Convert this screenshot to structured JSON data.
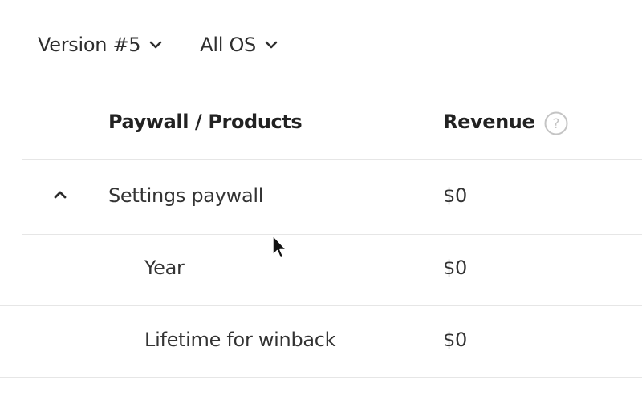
{
  "filters": {
    "version": {
      "label": "Version #5",
      "icon": "chevron-down-icon"
    },
    "os": {
      "label": "All OS",
      "icon": "chevron-down-icon"
    }
  },
  "table": {
    "columns": {
      "name": "Paywall / Products",
      "revenue": "Revenue"
    },
    "help_icon": "question-circle-icon",
    "paywall": {
      "name": "Settings paywall",
      "revenue": "$0",
      "expanded": true,
      "toggle_icon": "chevron-up-icon",
      "products": [
        {
          "name": "Year",
          "revenue": "$0"
        },
        {
          "name": "Lifetime for winback",
          "revenue": "$0"
        }
      ]
    }
  },
  "colors": {
    "text": "#2b2b2b",
    "divider": "#e6e6e6",
    "help_icon": "#c4c4c4"
  }
}
